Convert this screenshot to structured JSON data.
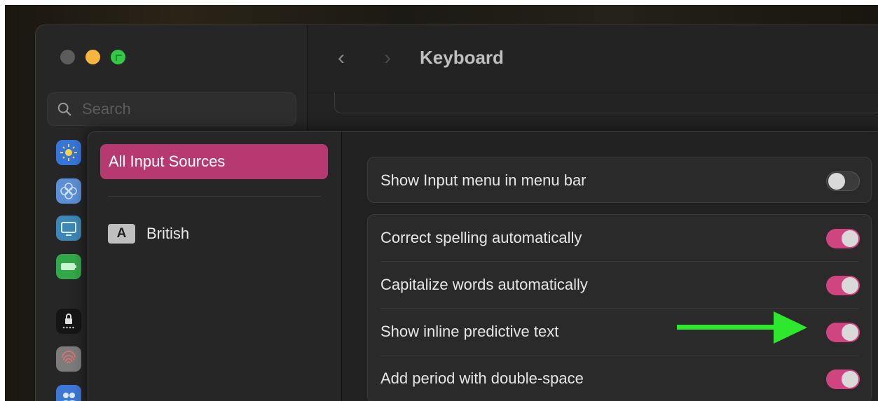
{
  "window": {
    "title": "Keyboard",
    "back_label": "‹",
    "forward_label": "›"
  },
  "search": {
    "placeholder": "Search"
  },
  "input_sources": {
    "selected_label": "All Input Sources",
    "sources": [
      {
        "badge": "A",
        "label": "British"
      }
    ]
  },
  "settings": {
    "show_input_menu": {
      "label": "Show Input menu in menu bar",
      "enabled": false
    },
    "correct_spelling": {
      "label": "Correct spelling automatically",
      "enabled": true
    },
    "capitalize_words": {
      "label": "Capitalize words automatically",
      "enabled": true
    },
    "inline_predictive": {
      "label": "Show inline predictive text",
      "enabled": true
    },
    "period_double_space": {
      "label": "Add period with double-space",
      "enabled": true
    }
  },
  "colors": {
    "accent": "#d0457f",
    "selection": "#b63a71",
    "annotation_arrow": "#2ee82e"
  },
  "annotation": {
    "icon": "green-arrow-icon"
  }
}
